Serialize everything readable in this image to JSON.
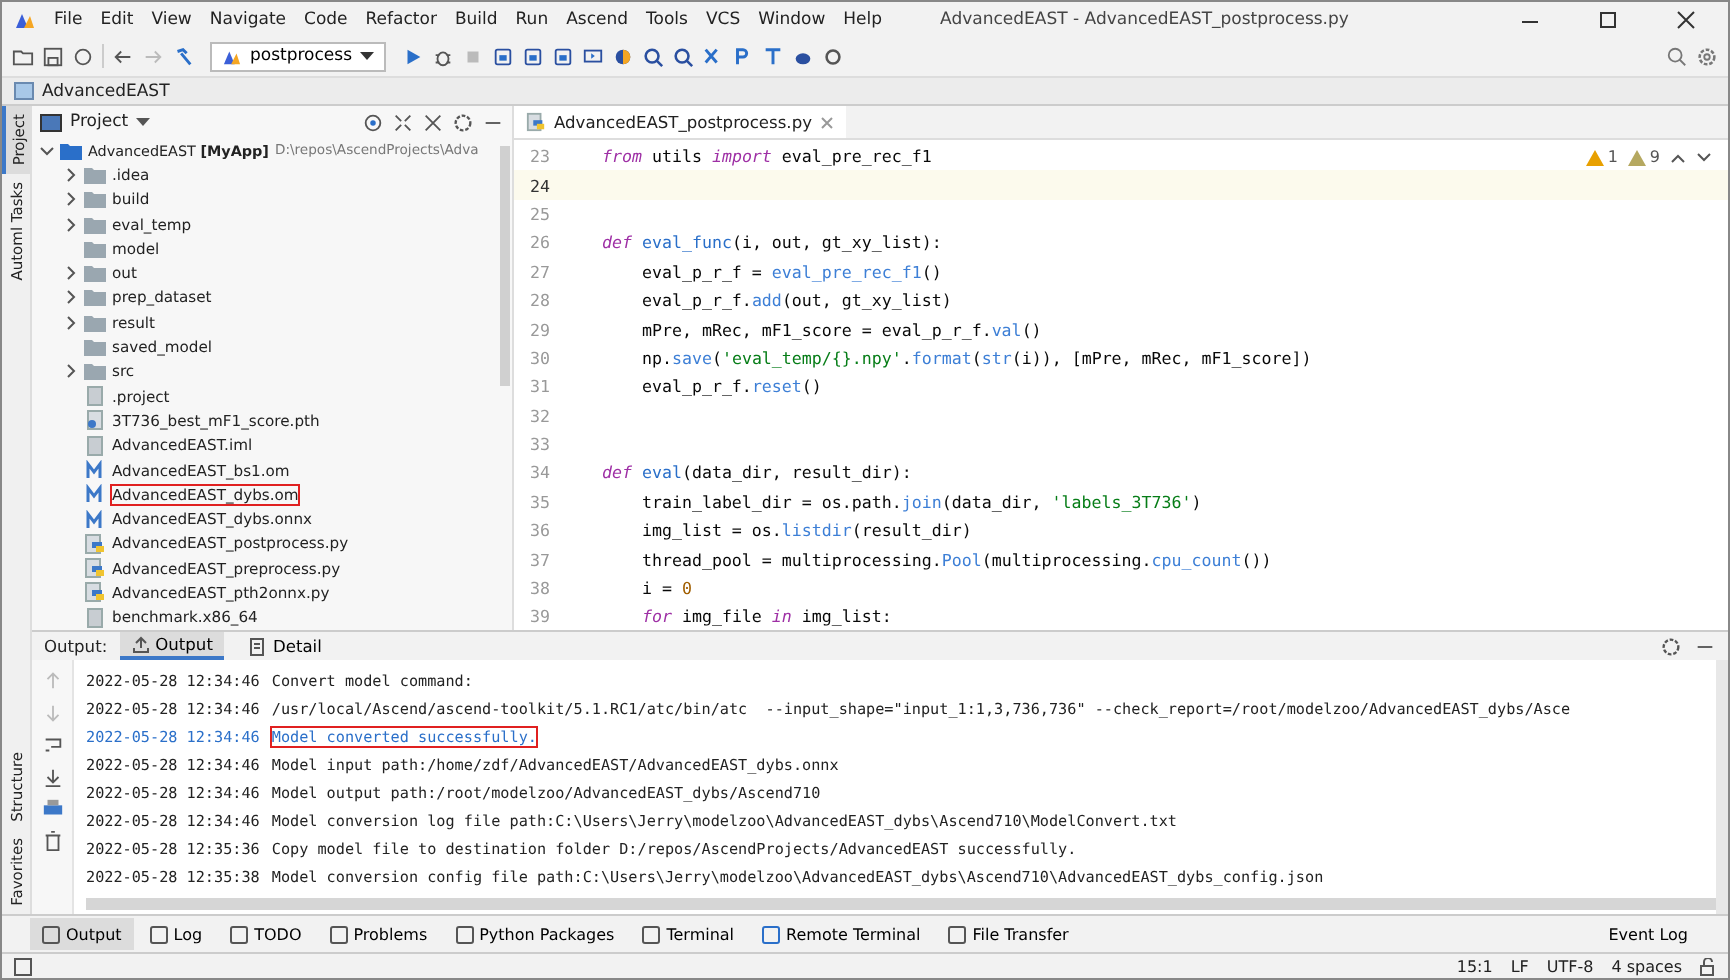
{
  "window": {
    "title": "AdvancedEAST - AdvancedEAST_postprocess.py"
  },
  "menu": [
    "File",
    "Edit",
    "View",
    "Navigate",
    "Code",
    "Refactor",
    "Build",
    "Run",
    "Ascend",
    "Tools",
    "VCS",
    "Window",
    "Help"
  ],
  "toolbar": {
    "run_config": "postprocess"
  },
  "breadcrumb": "AdvancedEAST",
  "left_stripe": [
    {
      "label": "Project",
      "selected": true
    },
    {
      "label": "Automl Tasks",
      "selected": false
    }
  ],
  "left_stripe_bottom": [
    {
      "label": "Structure"
    },
    {
      "label": "Favorites"
    }
  ],
  "project_panel": {
    "title": "Project",
    "root": {
      "name": "AdvancedEAST",
      "module": "[MyApp]",
      "path": "D:\\repos\\AscendProjects\\Adva",
      "expanded": true,
      "children": [
        {
          "name": ".idea",
          "kind": "folder",
          "expandable": true,
          "marked": false
        },
        {
          "name": "build",
          "kind": "folder",
          "expandable": true,
          "marked": false
        },
        {
          "name": "eval_temp",
          "kind": "folder",
          "expandable": true,
          "marked": false
        },
        {
          "name": "model",
          "kind": "folder",
          "expandable": false,
          "marked": false
        },
        {
          "name": "out",
          "kind": "folder",
          "expandable": true,
          "marked": false
        },
        {
          "name": "prep_dataset",
          "kind": "folder",
          "expandable": true,
          "marked": false
        },
        {
          "name": "result",
          "kind": "folder",
          "expandable": true,
          "marked": false
        },
        {
          "name": "saved_model",
          "kind": "folder",
          "expandable": false,
          "marked": false
        },
        {
          "name": "src",
          "kind": "folder",
          "expandable": true,
          "marked": false
        },
        {
          "name": ".project",
          "kind": "file",
          "expandable": false,
          "marked": false
        },
        {
          "name": "3T736_best_mF1_score.pth",
          "kind": "unknown",
          "expandable": false,
          "marked": false
        },
        {
          "name": "AdvancedEAST.iml",
          "kind": "file",
          "expandable": false,
          "marked": false
        },
        {
          "name": "AdvancedEAST_bs1.om",
          "kind": "model",
          "expandable": false,
          "marked": false
        },
        {
          "name": "AdvancedEAST_dybs.om",
          "kind": "model",
          "expandable": false,
          "marked": true
        },
        {
          "name": "AdvancedEAST_dybs.onnx",
          "kind": "model",
          "expandable": false,
          "marked": false
        },
        {
          "name": "AdvancedEAST_postprocess.py",
          "kind": "python",
          "expandable": false,
          "marked": false
        },
        {
          "name": "AdvancedEAST_preprocess.py",
          "kind": "python",
          "expandable": false,
          "marked": false
        },
        {
          "name": "AdvancedEAST_pth2onnx.py",
          "kind": "python",
          "expandable": false,
          "marked": false
        },
        {
          "name": "benchmark.x86_64",
          "kind": "file",
          "expandable": false,
          "marked": false
        }
      ]
    }
  },
  "editor": {
    "tab": "AdvancedEAST_postprocess.py",
    "warnings": "1",
    "weak_warnings": "9",
    "lines": [
      {
        "n": "23",
        "current": false,
        "tokens": [
          {
            "kind": "kw",
            "t": "from"
          },
          {
            "kind": "pl",
            "t": " utils "
          },
          {
            "kind": "kw",
            "t": "import"
          },
          {
            "kind": "pl",
            "t": " eval_pre_rec_f1"
          }
        ]
      },
      {
        "n": "24",
        "current": true
      },
      {
        "n": "25",
        "current": false
      },
      {
        "n": "26",
        "current": false,
        "tokens": [
          {
            "kind": "kw",
            "t": "def "
          },
          {
            "kind": "fn",
            "t": "eval_func"
          },
          {
            "kind": "pl",
            "t": "(i, out, gt_xy_list):"
          }
        ]
      },
      {
        "n": "27",
        "current": false,
        "tokens": [
          {
            "kind": "pl",
            "t": "    eval_p_r_f = "
          },
          {
            "kind": "call",
            "t": "eval_pre_rec_f1"
          },
          {
            "kind": "pl",
            "t": "()"
          }
        ]
      },
      {
        "n": "28",
        "current": false,
        "tokens": [
          {
            "kind": "pl",
            "t": "    eval_p_r_f."
          },
          {
            "kind": "call",
            "t": "add"
          },
          {
            "kind": "pl",
            "t": "(out, gt_xy_list)"
          }
        ]
      },
      {
        "n": "29",
        "current": false,
        "tokens": [
          {
            "kind": "pl",
            "t": "    mPre, mRec, mF1_score = eval_p_r_f."
          },
          {
            "kind": "call",
            "t": "val"
          },
          {
            "kind": "pl",
            "t": "()"
          }
        ]
      },
      {
        "n": "30",
        "current": false,
        "tokens": [
          {
            "kind": "pl",
            "t": "    np."
          },
          {
            "kind": "call",
            "t": "save"
          },
          {
            "kind": "pl",
            "t": "("
          },
          {
            "kind": "str",
            "t": "'eval_temp/{}.npy'"
          },
          {
            "kind": "pl",
            "t": "."
          },
          {
            "kind": "call",
            "t": "format"
          },
          {
            "kind": "pl",
            "t": "("
          },
          {
            "kind": "call",
            "t": "str"
          },
          {
            "kind": "pl",
            "t": "(i)), [mPre, mRec, mF1_score])"
          }
        ]
      },
      {
        "n": "31",
        "current": false,
        "tokens": [
          {
            "kind": "pl",
            "t": "    eval_p_r_f."
          },
          {
            "kind": "call",
            "t": "reset"
          },
          {
            "kind": "pl",
            "t": "()"
          }
        ]
      },
      {
        "n": "32",
        "current": false
      },
      {
        "n": "33",
        "current": false
      },
      {
        "n": "34",
        "current": false,
        "tokens": [
          {
            "kind": "kw",
            "t": "def "
          },
          {
            "kind": "fn",
            "t": "eval"
          },
          {
            "kind": "pl",
            "t": "(data_dir, result_dir):"
          }
        ]
      },
      {
        "n": "35",
        "current": false,
        "tokens": [
          {
            "kind": "pl",
            "t": "    train_label_dir = os.path."
          },
          {
            "kind": "call",
            "t": "join"
          },
          {
            "kind": "pl",
            "t": "(data_dir, "
          },
          {
            "kind": "str",
            "t": "'labels_3T736'"
          },
          {
            "kind": "pl",
            "t": ")"
          }
        ]
      },
      {
        "n": "36",
        "current": false,
        "tokens": [
          {
            "kind": "pl",
            "t": "    img_list = os."
          },
          {
            "kind": "call",
            "t": "listdir"
          },
          {
            "kind": "pl",
            "t": "(result_dir)"
          }
        ]
      },
      {
        "n": "37",
        "current": false,
        "tokens": [
          {
            "kind": "pl",
            "t": "    thread_pool = multiprocessing."
          },
          {
            "kind": "call",
            "t": "Pool"
          },
          {
            "kind": "pl",
            "t": "(multiprocessing."
          },
          {
            "kind": "call",
            "t": "cpu_count"
          },
          {
            "kind": "pl",
            "t": "())"
          }
        ]
      },
      {
        "n": "38",
        "current": false,
        "tokens": [
          {
            "kind": "pl",
            "t": "    i = "
          },
          {
            "kind": "num",
            "t": "0"
          }
        ]
      },
      {
        "n": "39",
        "current": false,
        "tokens": [
          {
            "kind": "kw",
            "t": "    for"
          },
          {
            "kind": "pl",
            "t": " img_file "
          },
          {
            "kind": "kw",
            "t": "in"
          },
          {
            "kind": "pl",
            "t": " img_list:"
          }
        ]
      }
    ]
  },
  "output_panel": {
    "label": "Output:",
    "tabs": [
      {
        "label": "Output",
        "selected": true
      },
      {
        "label": "Detail",
        "selected": false
      }
    ],
    "lines": [
      {
        "time": "2022-05-28 12:34:46",
        "text": "Convert model command:",
        "highlighted": false
      },
      {
        "time": "2022-05-28 12:34:46",
        "text": "/usr/local/Ascend/ascend-toolkit/5.1.RC1/atc/bin/atc  --input_shape=\"input_1:1,3,736,736\" --check_report=/root/modelzoo/AdvancedEAST_dybs/Asce",
        "highlighted": false
      },
      {
        "time": "2022-05-28 12:34:46",
        "text": "Model converted successfully.",
        "highlighted": true
      },
      {
        "time": "2022-05-28 12:34:46",
        "text": "Model input path:/home/zdf/AdvancedEAST/AdvancedEAST_dybs.onnx",
        "highlighted": false
      },
      {
        "time": "2022-05-28 12:34:46",
        "text": "Model output path:/root/modelzoo/AdvancedEAST_dybs/Ascend710",
        "highlighted": false
      },
      {
        "time": "2022-05-28 12:34:46",
        "text": "Model conversion log file path:C:\\Users\\Jerry\\modelzoo\\AdvancedEAST_dybs\\Ascend710\\ModelConvert.txt",
        "highlighted": false
      },
      {
        "time": "2022-05-28 12:35:36",
        "text": "Copy model file to destination folder D:/repos/AscendProjects/AdvancedEAST successfully.",
        "highlighted": false
      },
      {
        "time": "2022-05-28 12:35:38",
        "text": "Model conversion config file path:C:\\Users\\Jerry\\modelzoo\\AdvancedEAST_dybs\\Ascend710\\AdvancedEAST_dybs_config.json",
        "highlighted": false
      }
    ]
  },
  "tool_tabs": [
    {
      "label": "Output",
      "selected": true
    },
    {
      "label": "Log",
      "selected": false
    },
    {
      "label": "TODO",
      "selected": false
    },
    {
      "label": "Problems",
      "selected": false
    },
    {
      "label": "Python Packages",
      "selected": false
    },
    {
      "label": "Terminal",
      "selected": false
    },
    {
      "label": "Remote Terminal",
      "selected": false
    },
    {
      "label": "File Transfer",
      "selected": false
    }
  ],
  "event_log": "Event Log",
  "status_bar": {
    "position": "15:1",
    "line_sep": "LF",
    "encoding": "UTF-8",
    "indent": "4 spaces"
  }
}
